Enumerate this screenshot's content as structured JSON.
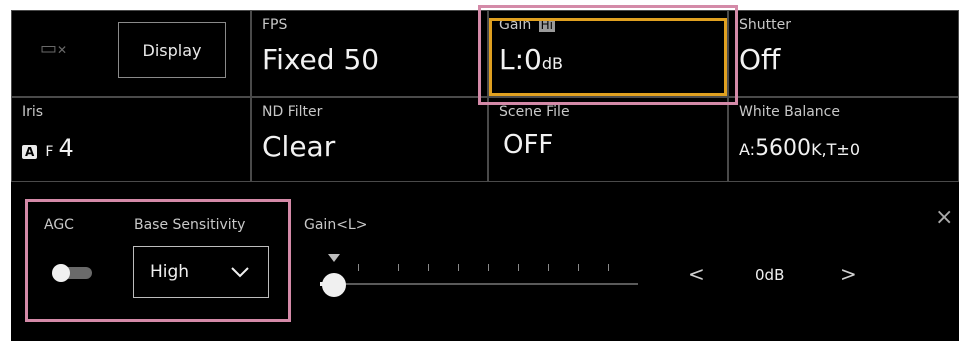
{
  "top_bar": {
    "display_button": "Display",
    "fps": {
      "label": "FPS",
      "value": "Fixed 50"
    },
    "gain": {
      "label": "Gain",
      "badge": "Hi",
      "value_prefix": "L:",
      "value": "0",
      "unit": "dB"
    },
    "shutter": {
      "label": "Shutter",
      "value": "Off"
    }
  },
  "middle_bar": {
    "iris": {
      "label": "Iris",
      "badge": "A",
      "f_prefix": "F",
      "value": "4"
    },
    "nd_filter": {
      "label": "ND Filter",
      "value": "Clear"
    },
    "scene_file": {
      "label": "Scene File",
      "value": "OFF"
    },
    "white_balance": {
      "label": "White Balance",
      "mode": "A:",
      "value": "5600",
      "unit": "K,",
      "tint": "T±0"
    }
  },
  "detail_panel": {
    "agc_label": "AGC",
    "agc_on": false,
    "base_sensitivity_label": "Base Sensitivity",
    "base_sensitivity_value": "High",
    "gain_slider_label": "Gain<L>",
    "gain_slider_level": 0.0,
    "gain_value": "0dB",
    "prev_glyph": "<",
    "next_glyph": ">",
    "close_glyph": "×"
  },
  "colors": {
    "highlight_pink": "#d48aa8",
    "selection_orange": "#e0a020"
  }
}
